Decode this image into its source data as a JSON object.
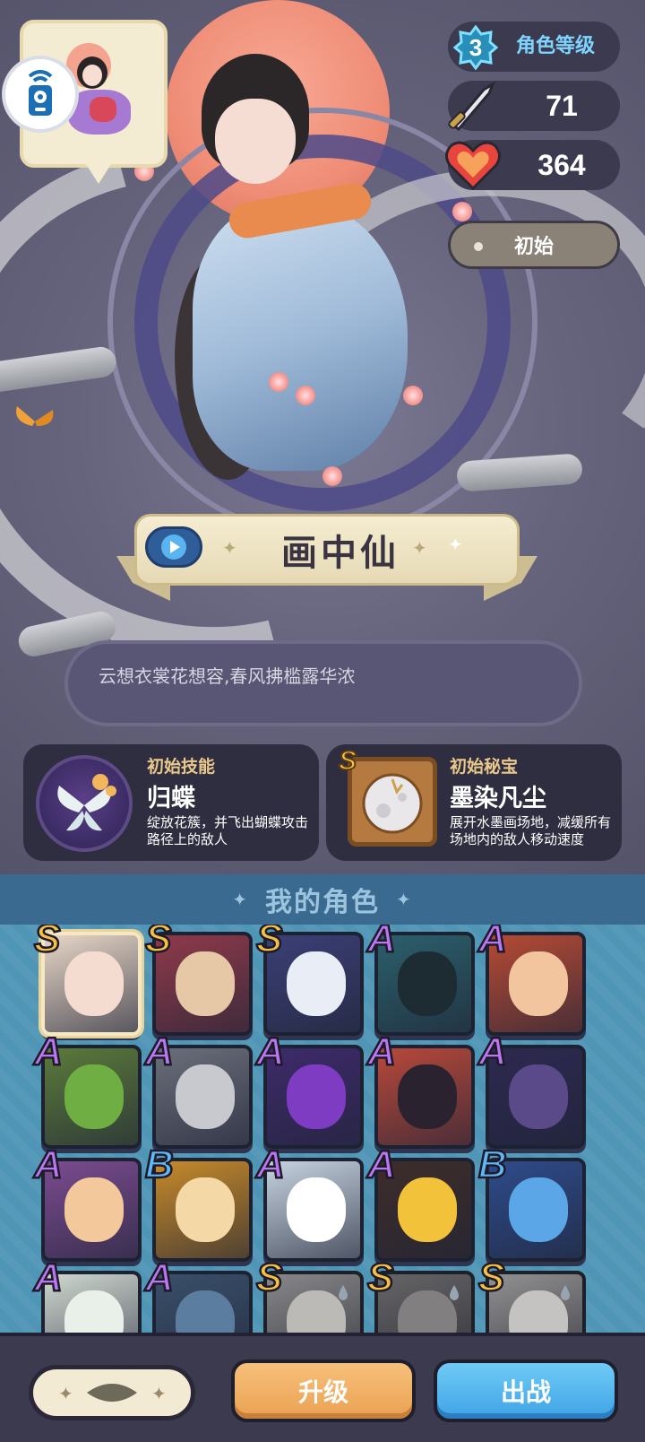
{
  "stats": {
    "level_value": "3",
    "level_label": "角色等级",
    "attack": "71",
    "health": "364",
    "state_label": "初始"
  },
  "hero": {
    "name": "画中仙",
    "quote": "云想衣裳花想容,春风拂槛露华浓"
  },
  "skill": {
    "kicker": "初始技能",
    "name": "归蝶",
    "desc": "绽放花簇，并飞出蝴蝶攻击路径上的敌人"
  },
  "treasure": {
    "kicker": "初始秘宝",
    "rank": "S",
    "name": "墨染凡尘",
    "desc": "展开水墨画场地，减缓所有场地内的敌人移动速度"
  },
  "roster": {
    "title": "我的角色",
    "heroes": [
      {
        "rank": "S",
        "color": "#e8d6c6",
        "face": "#f5dcd0",
        "selected": true
      },
      {
        "rank": "S",
        "color": "#8f3a4a",
        "face": "#e6c7a6"
      },
      {
        "rank": "S",
        "color": "#3b3f75",
        "face": "#e9edf5"
      },
      {
        "rank": "A",
        "color": "#2b5f6a",
        "face": "#1d2b33"
      },
      {
        "rank": "A",
        "color": "#b54a35",
        "face": "#f2c59e"
      },
      {
        "rank": "A",
        "color": "#5b7a3a",
        "face": "#6fae43"
      },
      {
        "rank": "A",
        "color": "#6b6e7a",
        "face": "#c7c9cf"
      },
      {
        "rank": "A",
        "color": "#3e2a6a",
        "face": "#7d3cc2"
      },
      {
        "rank": "A",
        "color": "#b8483a",
        "face": "#2b2230"
      },
      {
        "rank": "A",
        "color": "#2d2950",
        "face": "#5a4a8a"
      },
      {
        "rank": "A",
        "color": "#7b4b8f",
        "face": "#f3c89b"
      },
      {
        "rank": "B",
        "color": "#c78a2a",
        "face": "#f4d9a6"
      },
      {
        "rank": "A",
        "color": "#c7d3e0",
        "face": "#ffffff"
      },
      {
        "rank": "A",
        "color": "#3e2d2a",
        "face": "#f2c23b"
      },
      {
        "rank": "B",
        "color": "#2e4b8a",
        "face": "#5aa6e6"
      },
      {
        "rank": "A",
        "color": "#cfd7cf",
        "face": "#e9efe9"
      },
      {
        "rank": "A",
        "color": "#3a4f6a",
        "face": "#5b7ea0"
      },
      {
        "rank": "S",
        "color": "#8e8e96",
        "face": "#c9c3bd",
        "locked": true
      },
      {
        "rank": "S",
        "color": "#6c6870",
        "face": "#8c8488",
        "locked": true
      },
      {
        "rank": "S",
        "color": "#9a969c",
        "face": "#d2cdc8",
        "locked": true
      }
    ]
  },
  "actions": {
    "upgrade_label": "升级",
    "deploy_label": "出战"
  },
  "colors": {
    "accent_blue": "#7fd5ff",
    "rank_s": "#f5c144",
    "rank_a": "#b978f2",
    "rank_b": "#5fb7f5"
  }
}
